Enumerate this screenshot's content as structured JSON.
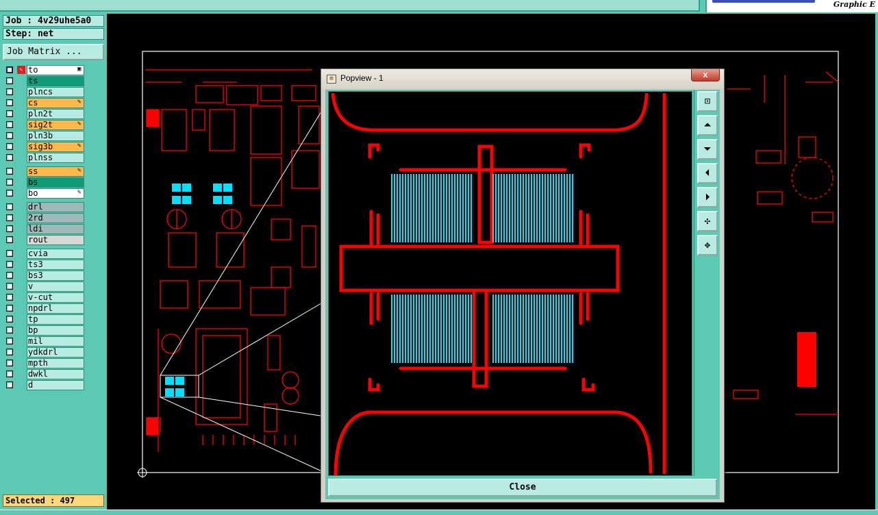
{
  "header": {
    "brand_tagline": "Graphic E"
  },
  "job": {
    "job_label": "Job : 4v29uhe5a0",
    "step_label": "Step: net",
    "matrix_button": "Job Matrix ..."
  },
  "layers": [
    {
      "name": "to",
      "color": "#ffffff",
      "edit": true,
      "active": true
    },
    {
      "name": "ts",
      "color": "#0f9a78",
      "edit": false
    },
    {
      "name": "plncs",
      "color": "#b8ebe1",
      "edit": false
    },
    {
      "name": "cs",
      "color": "#ffb84a",
      "edit": true
    },
    {
      "name": "pln2t",
      "color": "#b8ebe1",
      "edit": false
    },
    {
      "name": "sig2t",
      "color": "#ffb84a",
      "edit": true
    },
    {
      "name": "pln3b",
      "color": "#b8ebe1",
      "edit": false
    },
    {
      "name": "sig3b",
      "color": "#ffb84a",
      "edit": true
    },
    {
      "name": "plnss",
      "color": "#b8ebe1",
      "edit": false
    },
    {
      "name": "ss",
      "color": "#ffb84a",
      "edit": true
    },
    {
      "name": "bs",
      "color": "#0f9a78",
      "edit": false
    },
    {
      "name": "bo",
      "color": "#ffffff",
      "edit": true
    },
    {
      "name": "drl",
      "color": "#9fb8b8",
      "edit": false
    },
    {
      "name": "2rd",
      "color": "#9fb8b8",
      "edit": false
    },
    {
      "name": "ldi",
      "color": "#9fb8b8",
      "edit": false
    },
    {
      "name": "rout",
      "color": "#d8d8d8",
      "edit": false
    },
    {
      "name": "cvia",
      "color": "#b8ebe1",
      "edit": false
    },
    {
      "name": "ts3",
      "color": "#b8ebe1",
      "edit": false
    },
    {
      "name": "bs3",
      "color": "#b8ebe1",
      "edit": false
    },
    {
      "name": "v",
      "color": "#b8ebe1",
      "edit": false
    },
    {
      "name": "v-cut",
      "color": "#b8ebe1",
      "edit": false
    },
    {
      "name": "npdrl",
      "color": "#b8ebe1",
      "edit": false
    },
    {
      "name": "tp",
      "color": "#b8ebe1",
      "edit": false
    },
    {
      "name": "bp",
      "color": "#b8ebe1",
      "edit": false
    },
    {
      "name": "mil",
      "color": "#b8ebe1",
      "edit": false
    },
    {
      "name": "ydkdrl",
      "color": "#b8ebe1",
      "edit": false
    },
    {
      "name": "mpth",
      "color": "#b8ebe1",
      "edit": false
    },
    {
      "name": "dwkl",
      "color": "#b8ebe1",
      "edit": false
    },
    {
      "name": "d",
      "color": "#b8ebe1",
      "edit": false
    }
  ],
  "status": {
    "selected": "Selected : 497"
  },
  "popview": {
    "title": "Popview - 1",
    "close_x": "x",
    "close_button": "Close",
    "tools": [
      "zoom-fit-icon",
      "pan-up-icon",
      "pan-down-icon",
      "pan-left-icon",
      "pan-right-icon",
      "zoom-in-icon",
      "zoom-out-icon"
    ]
  },
  "colors": {
    "trace": "#ff0000",
    "pad": "#00e0ff",
    "panel": "#5cc9b4",
    "panel_light": "#b8ebe1"
  }
}
